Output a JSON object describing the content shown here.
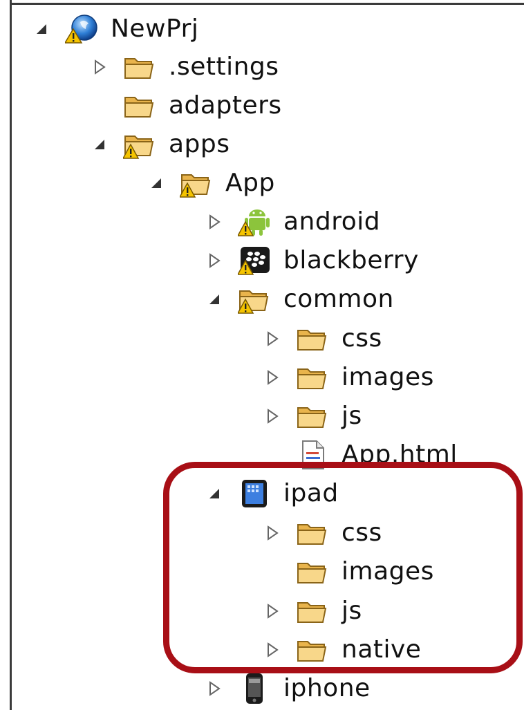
{
  "tree": {
    "root": {
      "label": "NewPrj",
      "icon": "project-icon",
      "expanded": true
    },
    "items": [
      {
        "label": ".settings",
        "icon": "folder-icon",
        "toggle": "collapsed",
        "depth": 1
      },
      {
        "label": "adapters",
        "icon": "folder-icon",
        "toggle": "none",
        "depth": 1
      },
      {
        "label": "apps",
        "icon": "folder-warning-icon",
        "toggle": "expanded",
        "depth": 1
      },
      {
        "label": "App",
        "icon": "folder-warning-icon",
        "toggle": "expanded",
        "depth": 2
      },
      {
        "label": "android",
        "icon": "android-icon",
        "toggle": "collapsed",
        "depth": 3
      },
      {
        "label": "blackberry",
        "icon": "blackberry-icon",
        "toggle": "collapsed",
        "depth": 3
      },
      {
        "label": "common",
        "icon": "folder-warning-icon",
        "toggle": "expanded",
        "depth": 3
      },
      {
        "label": "css",
        "icon": "folder-icon",
        "toggle": "collapsed",
        "depth": 4
      },
      {
        "label": "images",
        "icon": "folder-icon",
        "toggle": "collapsed",
        "depth": 4
      },
      {
        "label": "js",
        "icon": "folder-icon",
        "toggle": "collapsed",
        "depth": 4
      },
      {
        "label": "App.html",
        "icon": "html-file-icon",
        "toggle": "none",
        "depth": 4
      },
      {
        "label": "ipad",
        "icon": "ipad-icon",
        "toggle": "expanded",
        "depth": 3
      },
      {
        "label": "css",
        "icon": "folder-icon",
        "toggle": "collapsed",
        "depth": 4
      },
      {
        "label": "images",
        "icon": "folder-icon",
        "toggle": "none",
        "depth": 4
      },
      {
        "label": "js",
        "icon": "folder-icon",
        "toggle": "collapsed",
        "depth": 4
      },
      {
        "label": "native",
        "icon": "folder-icon",
        "toggle": "collapsed",
        "depth": 4
      },
      {
        "label": "iphone",
        "icon": "iphone-icon",
        "toggle": "collapsed",
        "depth": 3
      }
    ]
  },
  "colors": {
    "highlight": "#a80f16",
    "folder": "#f3c96a",
    "warning": "#f5c400"
  }
}
